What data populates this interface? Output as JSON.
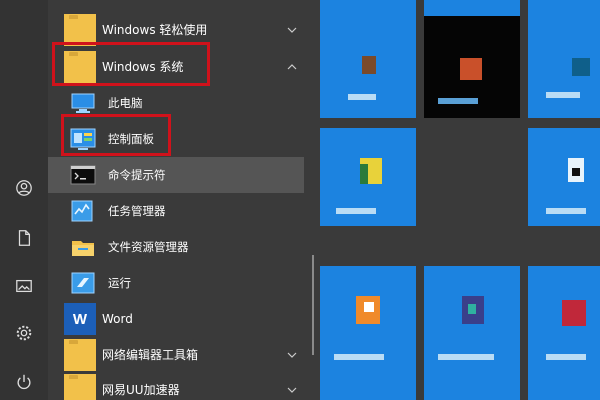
{
  "apps": {
    "windows_ease": "Windows 轻松使用",
    "windows_system": "Windows 系统",
    "this_pc": "此电脑",
    "control_panel": "控制面板",
    "cmd": "命令提示符",
    "task_manager": "任务管理器",
    "file_explorer": "文件资源管理器",
    "run": "运行",
    "word_icon_letter": "W",
    "word": "Word",
    "netease_tool": "网络编辑器工具箱",
    "netease_uu": "网易UU加速器"
  },
  "colors": {
    "accent_tile": "#1c83e0",
    "highlight_border": "#d0121b",
    "folder": "#f2c14a"
  },
  "icons": {
    "rail": [
      "user-icon",
      "document-icon",
      "pictures-icon",
      "settings-icon",
      "power-icon"
    ]
  }
}
